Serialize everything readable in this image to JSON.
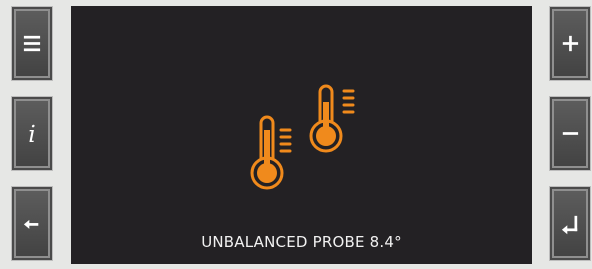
{
  "device": {
    "left_buttons": [
      {
        "name": "menu-button",
        "icon": "menu-icon"
      },
      {
        "name": "info-button",
        "icon": "info-icon"
      },
      {
        "name": "back-button",
        "icon": "arrow-left-icon"
      }
    ],
    "right_buttons": [
      {
        "name": "plus-button",
        "icon": "plus-icon"
      },
      {
        "name": "minus-button",
        "icon": "minus-icon"
      },
      {
        "name": "enter-button",
        "icon": "enter-icon"
      }
    ]
  },
  "screen": {
    "icon": "thermometer-probes-icon",
    "accent_color": "#f08a1c",
    "message": "UNBALANCED PROBE 8.4°"
  }
}
